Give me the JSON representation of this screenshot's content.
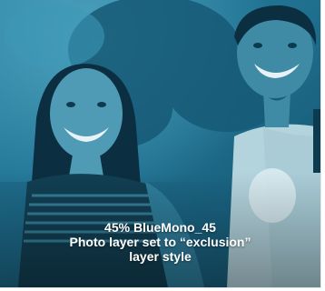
{
  "photo": {
    "label": "photo-tile"
  },
  "caption": {
    "line1": "45% BlueMono_45",
    "line2": "Photo layer set to “exclusion”",
    "line3": "layer style"
  },
  "colors": {
    "tint_dark": "#0f4a63",
    "tint_mid": "#1f6f8f",
    "tint_light": "#4aa3c0",
    "caption_text": "#ffffff"
  }
}
